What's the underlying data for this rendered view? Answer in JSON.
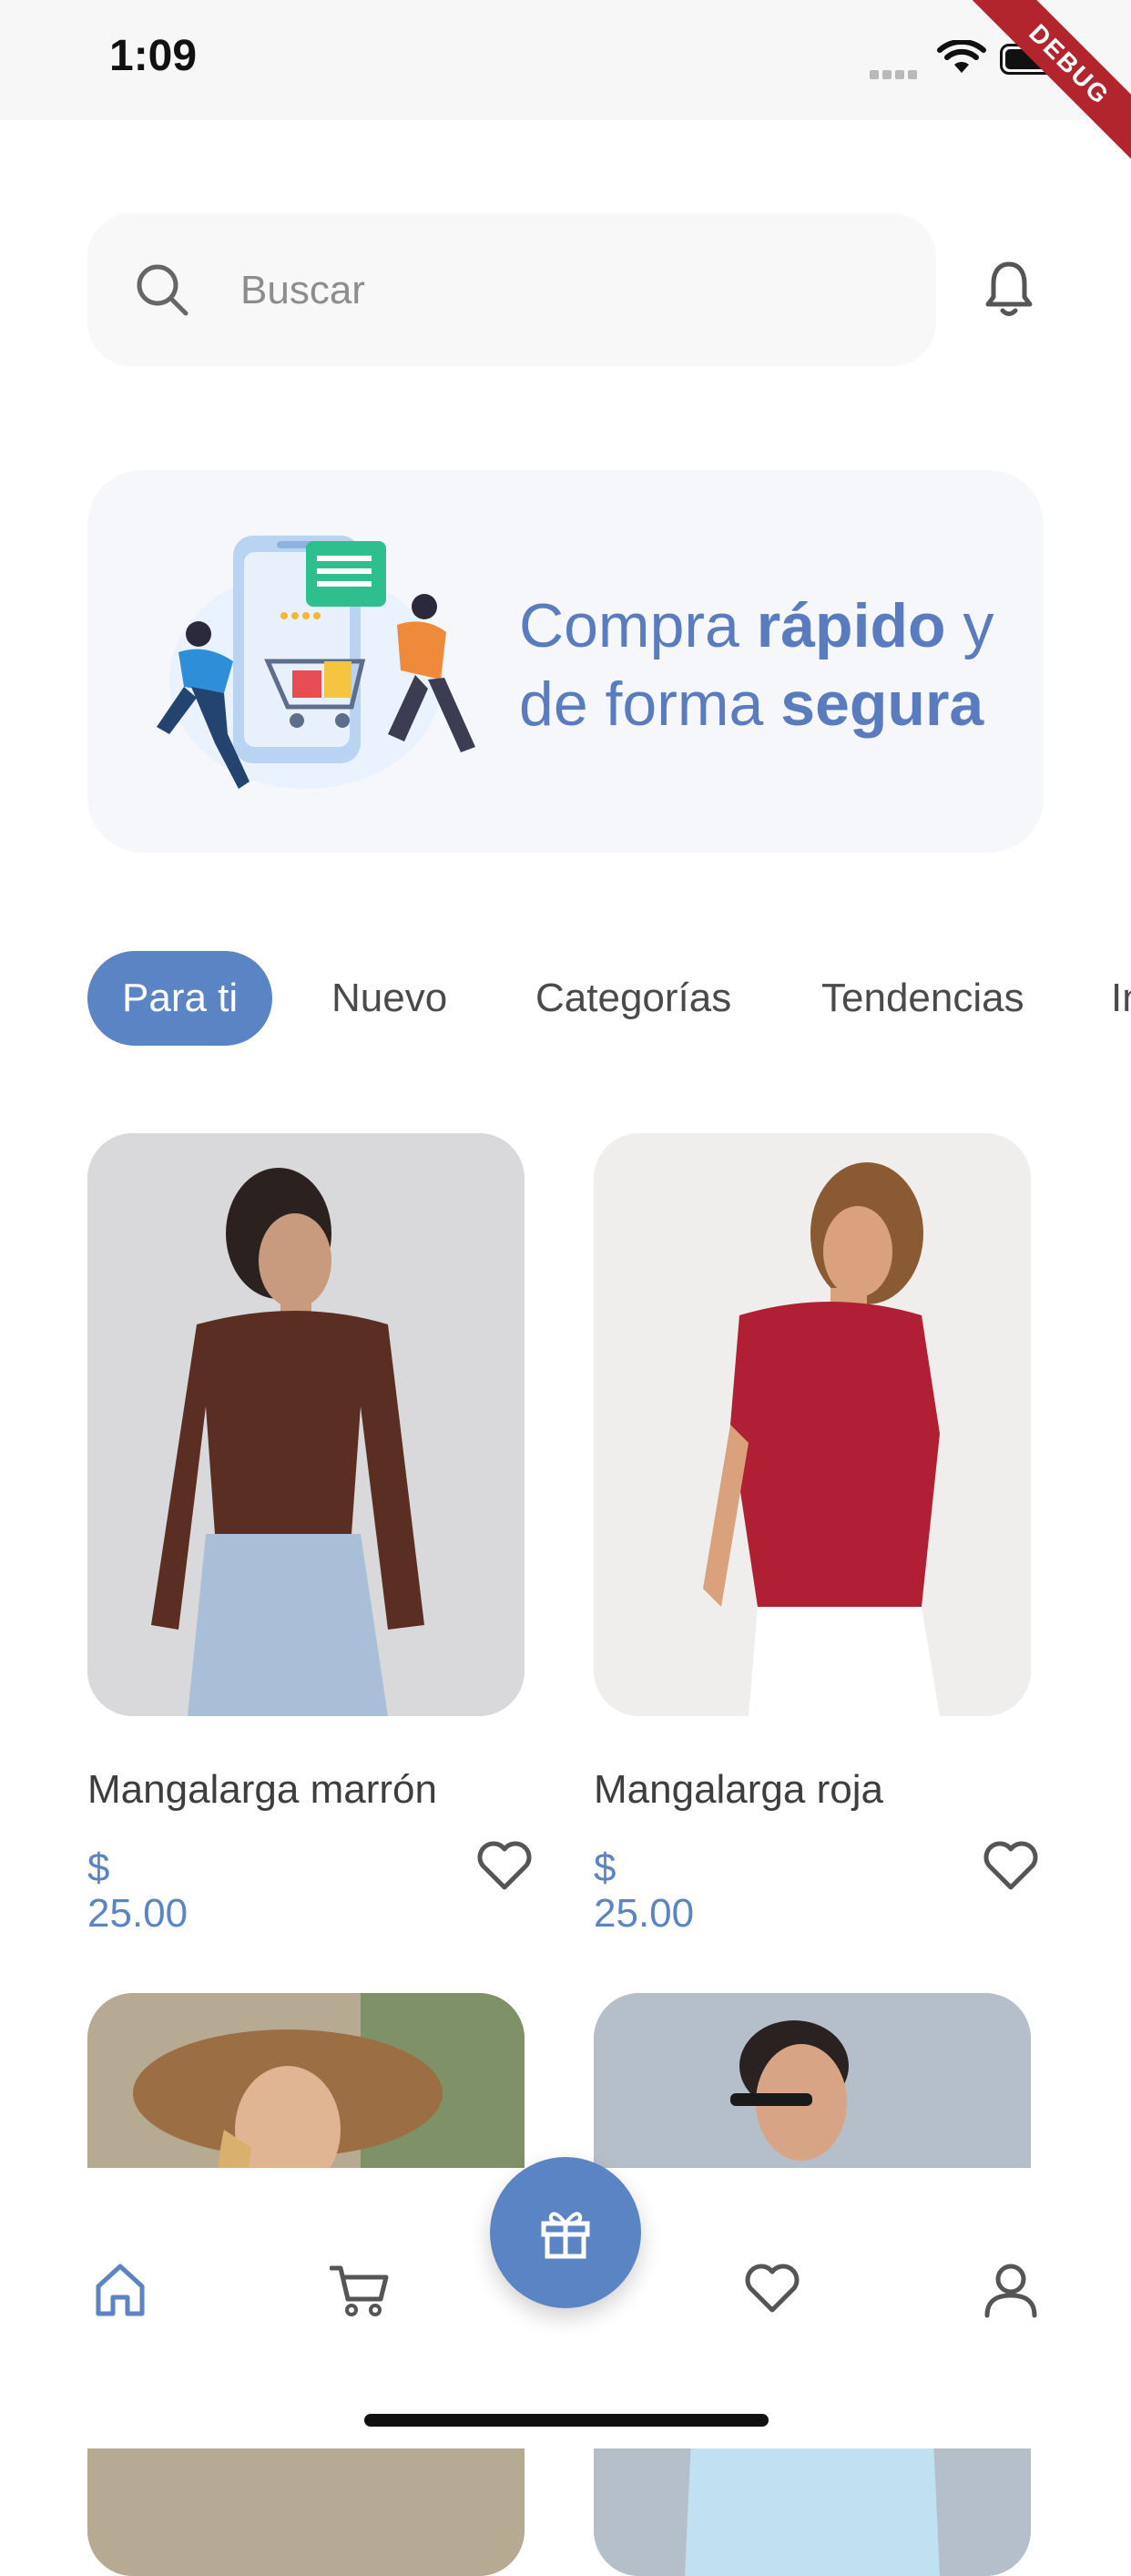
{
  "status_bar": {
    "time": "1:09",
    "debug_label": "DEBUG"
  },
  "search": {
    "placeholder": "Buscar"
  },
  "banner": {
    "line1_pre": "Compra ",
    "line1_bold": "rápido",
    "line1_post": " y",
    "line2_pre": "de forma ",
    "line2_bold": "segura"
  },
  "tabs": [
    {
      "label": "Para ti",
      "active": true
    },
    {
      "label": "Nuevo",
      "active": false
    },
    {
      "label": "Categorías",
      "active": false
    },
    {
      "label": "Tendencias",
      "active": false
    },
    {
      "label": "In",
      "active": false
    }
  ],
  "products": [
    {
      "name": "Mangalarga marrón",
      "price": "$ 25.00"
    },
    {
      "name": "Mangalarga roja",
      "price": "$ 25.00"
    }
  ],
  "bottom_nav": {
    "items": [
      "home-icon",
      "cart-icon",
      "gift-icon",
      "heart-icon",
      "user-icon"
    ],
    "active": "home-icon"
  },
  "colors": {
    "accent": "#5b84c4",
    "banner_bg": "#f5f7fb",
    "debug": "#b3252d"
  }
}
